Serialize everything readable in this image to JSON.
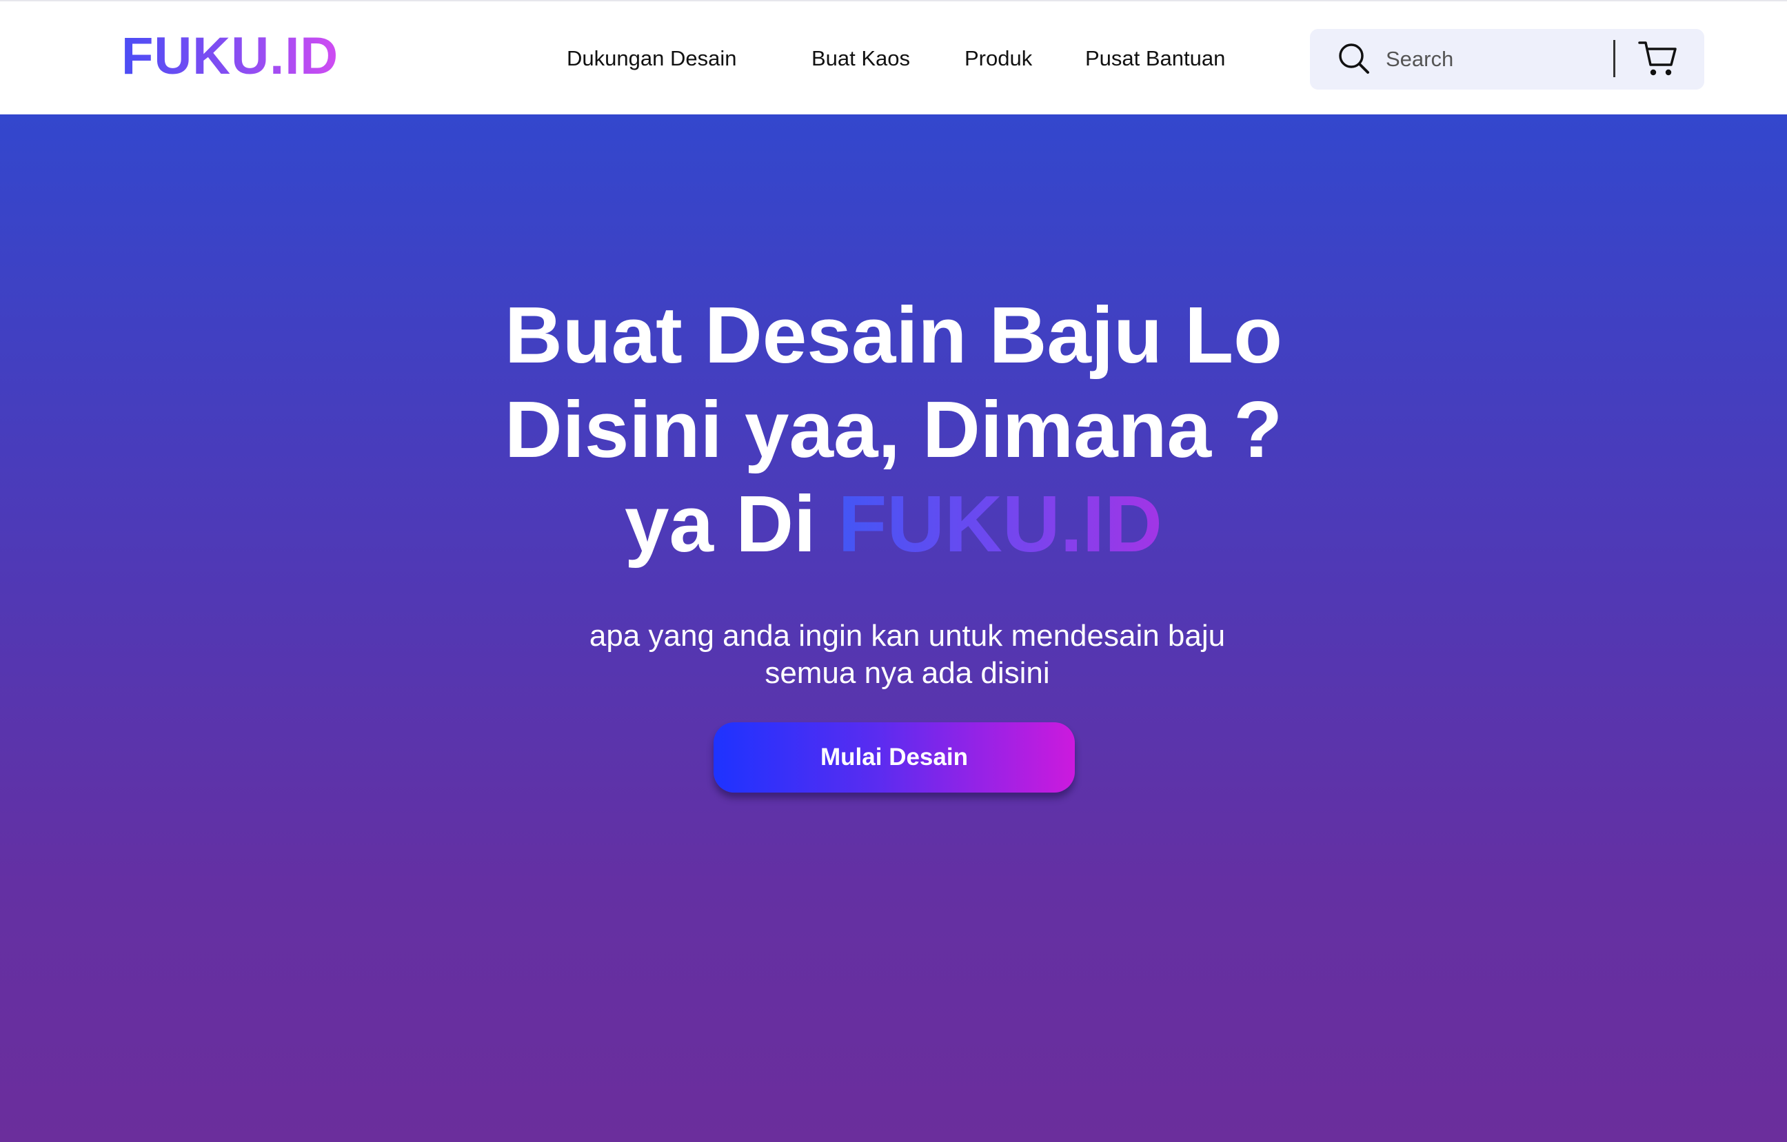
{
  "brand": {
    "logo_text": "FUKU.ID"
  },
  "nav": {
    "items": [
      {
        "label": "Dukungan Desain"
      },
      {
        "label": "Buat Kaos"
      },
      {
        "label": "Produk"
      },
      {
        "label": "Pusat Bantuan"
      }
    ]
  },
  "search": {
    "placeholder": "Search",
    "icon": "search-icon"
  },
  "cart": {
    "icon": "cart-icon"
  },
  "hero": {
    "title_line1": "Buat Desain Baju Lo",
    "title_line2": "Disini yaa, Dimana ?",
    "title_line3_prefix": "ya Di ",
    "title_line3_brand": "FUKU.ID",
    "subtitle_line1": "apa yang anda ingin kan untuk mendesain baju",
    "subtitle_line2": "semua nya ada disini",
    "cta_label": "Mulai Desain"
  },
  "colors": {
    "hero_top": "#3347cd",
    "hero_bottom": "#6b2e9c",
    "cta_start": "#1e33ff",
    "cta_end": "#cc1add",
    "logo_start": "#4b4df4",
    "logo_end": "#d04cf2",
    "search_bg": "#eef0fb"
  }
}
